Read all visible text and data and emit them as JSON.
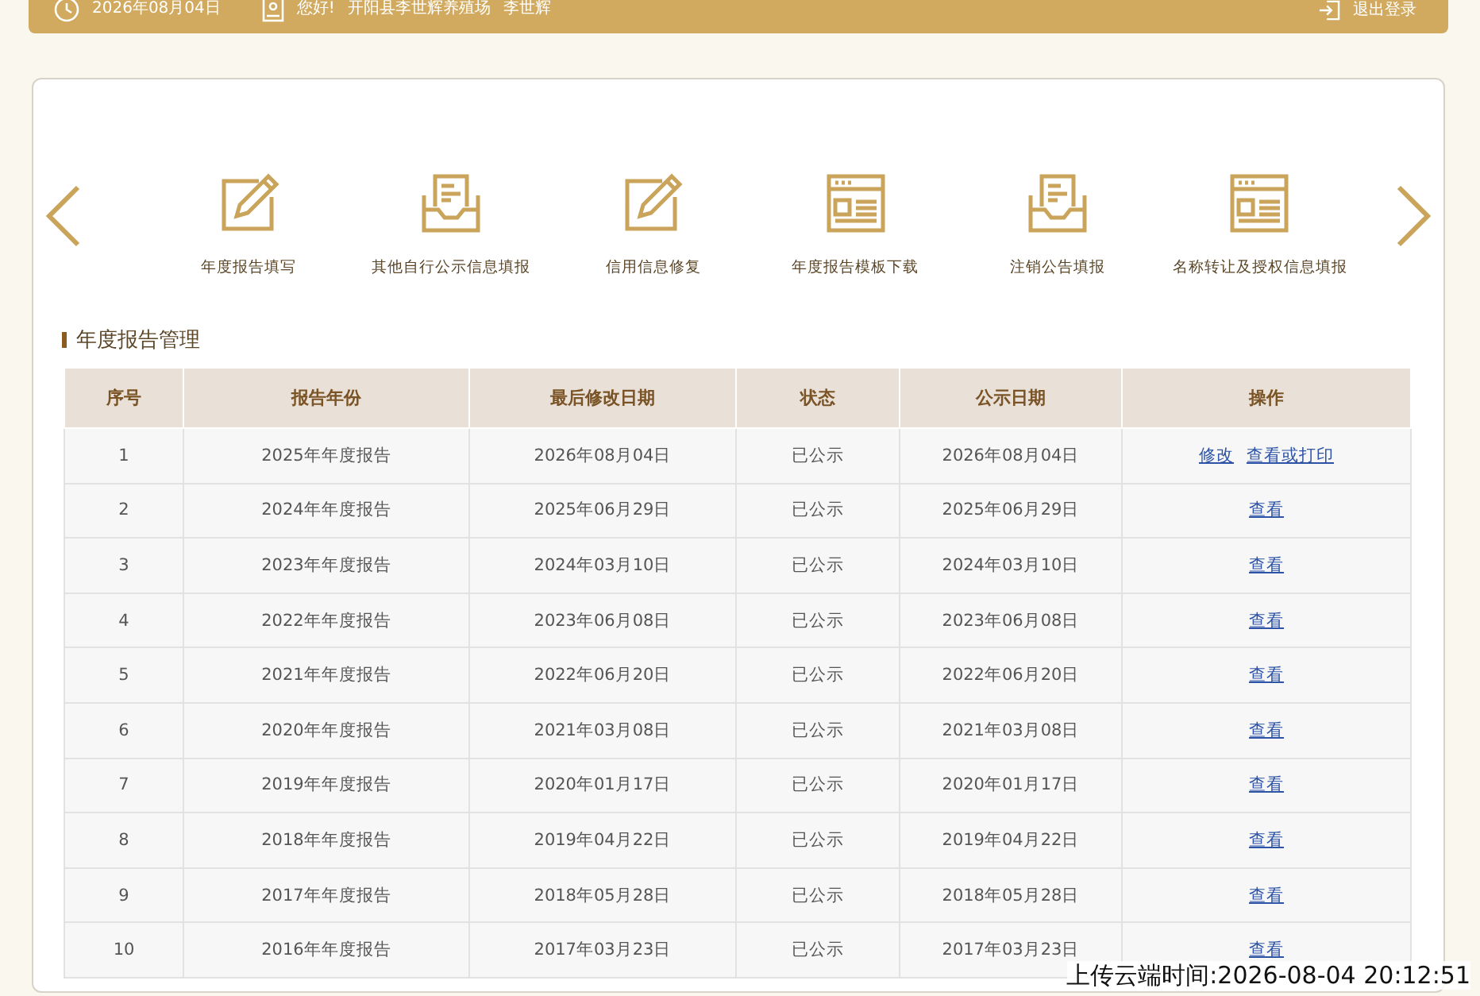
{
  "header": {
    "date": "2026年08月04日",
    "greeting": "您好!",
    "company": "开阳县李世辉养殖场",
    "user": "李世辉",
    "logout": "退出登录"
  },
  "services": [
    {
      "label": "年度报告填写",
      "kind": "edit"
    },
    {
      "label": "其他自行公示信息填报",
      "kind": "inbox"
    },
    {
      "label": "信用信息修复",
      "kind": "edit"
    },
    {
      "label": "年度报告模板下载",
      "kind": "form"
    },
    {
      "label": "注销公告填报",
      "kind": "inbox"
    },
    {
      "label": "名称转让及授权信息填报",
      "kind": "form"
    }
  ],
  "section_title": "年度报告管理",
  "table": {
    "columns": [
      "序号",
      "报告年份",
      "最后修改日期",
      "状态",
      "公示日期",
      "操作"
    ],
    "rows": [
      {
        "cells": [
          "1",
          "2025年年度报告",
          "2026年08月04日",
          "已公示",
          "2026年08月04日"
        ],
        "actions": [
          "修改",
          "查看或打印"
        ]
      },
      {
        "cells": [
          "2",
          "2024年年度报告",
          "2025年06月29日",
          "已公示",
          "2025年06月29日"
        ],
        "actions": [
          "查看"
        ]
      },
      {
        "cells": [
          "3",
          "2023年年度报告",
          "2024年03月10日",
          "已公示",
          "2024年03月10日"
        ],
        "actions": [
          "查看"
        ]
      },
      {
        "cells": [
          "4",
          "2022年年度报告",
          "2023年06月08日",
          "已公示",
          "2023年06月08日"
        ],
        "actions": [
          "查看"
        ]
      },
      {
        "cells": [
          "5",
          "2021年年度报告",
          "2022年06月20日",
          "已公示",
          "2022年06月20日"
        ],
        "actions": [
          "查看"
        ]
      },
      {
        "cells": [
          "6",
          "2020年年度报告",
          "2021年03月08日",
          "已公示",
          "2021年03月08日"
        ],
        "actions": [
          "查看"
        ]
      },
      {
        "cells": [
          "7",
          "2019年年度报告",
          "2020年01月17日",
          "已公示",
          "2020年01月17日"
        ],
        "actions": [
          "查看"
        ]
      },
      {
        "cells": [
          "8",
          "2018年年度报告",
          "2019年04月22日",
          "已公示",
          "2019年04月22日"
        ],
        "actions": [
          "查看"
        ]
      },
      {
        "cells": [
          "9",
          "2017年年度报告",
          "2018年05月28日",
          "已公示",
          "2018年05月28日"
        ],
        "actions": [
          "查看"
        ]
      },
      {
        "cells": [
          "10",
          "2016年年度报告",
          "2017年03月23日",
          "已公示",
          "2017年03月23日"
        ],
        "actions": [
          "查看"
        ]
      }
    ]
  },
  "upload_stamp": "上传云端时间:2026-08-04 20:12:51"
}
